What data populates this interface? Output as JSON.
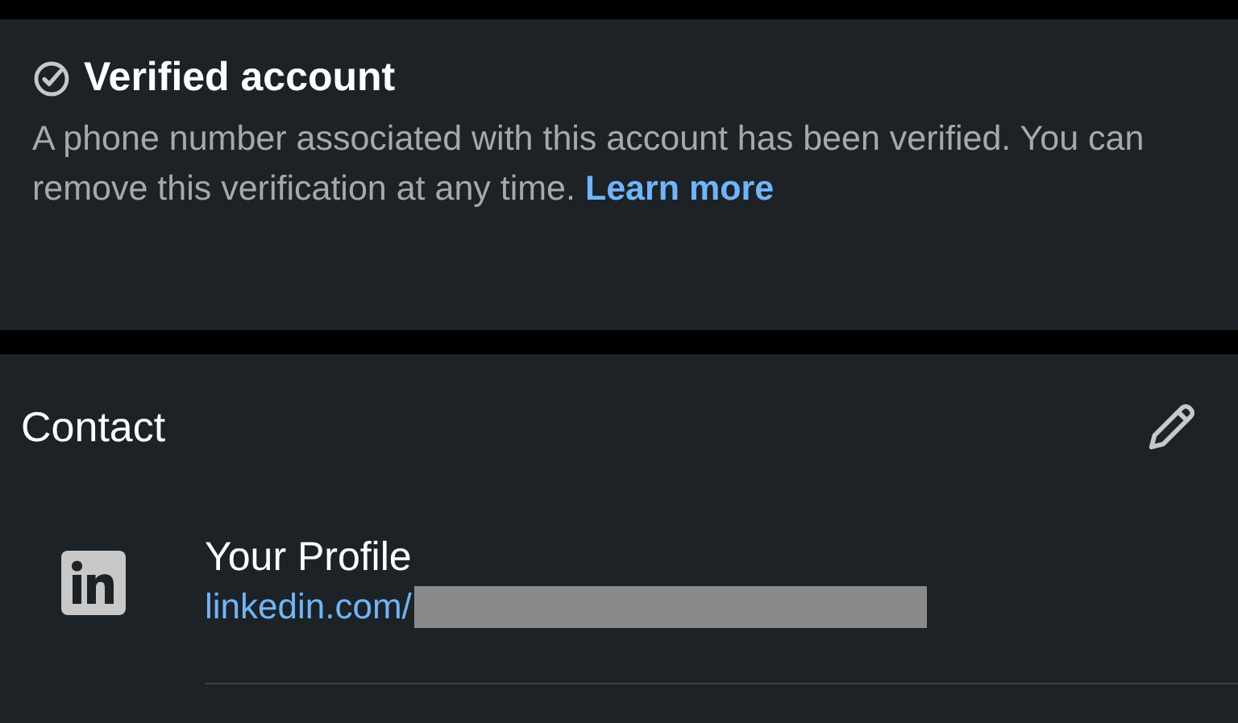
{
  "verified": {
    "title": "Verified account",
    "text": "A phone number associated with this account has been verified. You can remove this verification at any time.",
    "link": "Learn more"
  },
  "contact": {
    "title": "Contact",
    "items": [
      {
        "kind": "linkedin",
        "label": "Your Profile",
        "link": "linkedin.com/",
        "redacted": true
      }
    ]
  }
}
